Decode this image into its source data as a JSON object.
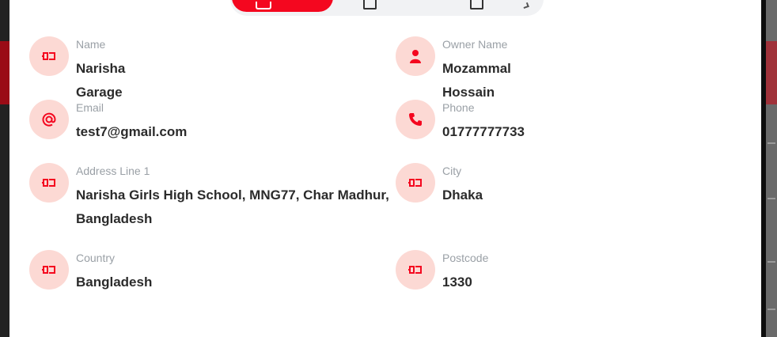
{
  "tabs": [
    {
      "name": "tab-garage",
      "active": true
    },
    {
      "name": "tab-second",
      "active": false
    },
    {
      "name": "tab-third",
      "active": false
    }
  ],
  "details": {
    "name": {
      "label": "Name",
      "value": "Narisha Garage",
      "icon": "plug-icon"
    },
    "owner_name": {
      "label": "Owner Name",
      "value": "Mozammal Hossain",
      "icon": "person-icon"
    },
    "email": {
      "label": "Email",
      "value": "test7@gmail.com",
      "icon": "at-sign-icon"
    },
    "phone": {
      "label": "Phone",
      "value": "01777777733",
      "icon": "phone-icon"
    },
    "address_line_1": {
      "label": "Address Line 1",
      "value": "Narisha Girls High School, MNG77, Char Madhur, Bangladesh",
      "icon": "plug-icon"
    },
    "city": {
      "label": "City",
      "value": "Dhaka",
      "icon": "plug-icon"
    },
    "country": {
      "label": "Country",
      "value": "Bangladesh",
      "icon": "plug-icon"
    },
    "postcode": {
      "label": "Postcode",
      "value": "1330",
      "icon": "plug-icon"
    }
  },
  "colors": {
    "accent": "#f4071f",
    "icon_bg": "#fcd9d4",
    "label": "#9aa0a6",
    "value": "#2b2b2b"
  }
}
